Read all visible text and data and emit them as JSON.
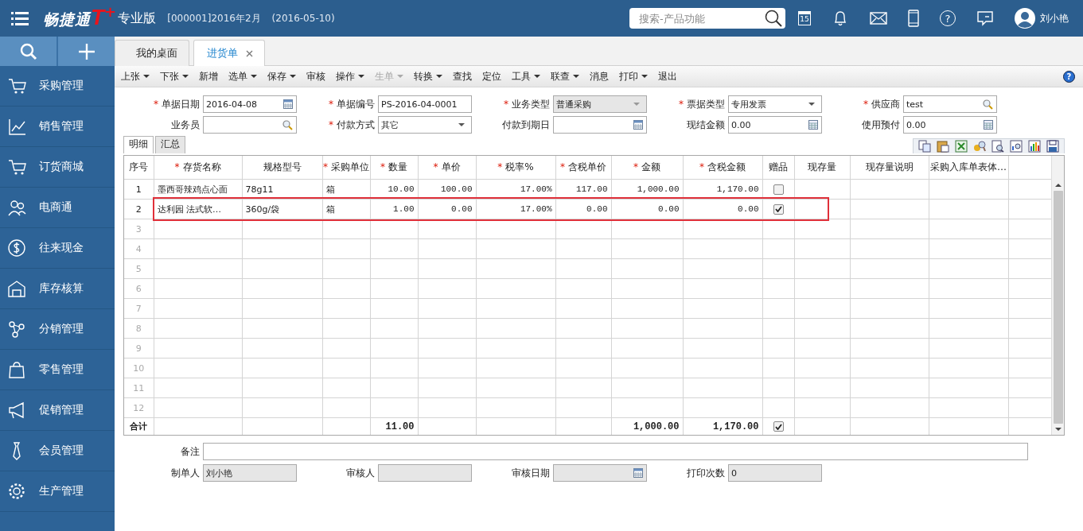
{
  "header": {
    "brand": "畅捷通",
    "brand_mark": "T",
    "brand_plus": "+",
    "edition": "专业版",
    "account": "[000001]2016年2月",
    "date": "(2016-05-10)",
    "search": {
      "placeholder": "搜索-产品功能"
    },
    "calendar_day": "15",
    "help": "?",
    "user": "刘小艳"
  },
  "sidebar": {
    "items": [
      {
        "label": "采购管理",
        "selected": false
      },
      {
        "label": "销售管理",
        "selected": false
      },
      {
        "label": "订货商城",
        "selected": false
      },
      {
        "label": "电商通",
        "selected": false
      },
      {
        "label": "往来现金",
        "selected": false
      },
      {
        "label": "库存核算",
        "selected": false
      },
      {
        "label": "分销管理",
        "selected": false
      },
      {
        "label": "零售管理",
        "selected": false
      },
      {
        "label": "促销管理",
        "selected": false
      },
      {
        "label": "会员管理",
        "selected": false
      },
      {
        "label": "生产管理",
        "selected": false
      }
    ]
  },
  "tabs": [
    {
      "label": "我的桌面",
      "selected": false,
      "closable": false
    },
    {
      "label": "进货单",
      "selected": true,
      "closable": true
    }
  ],
  "toolbar": {
    "items": [
      {
        "label": "上张",
        "dropdown": true,
        "disabled": false
      },
      {
        "label": "下张",
        "dropdown": true,
        "disabled": false
      },
      {
        "label": "新增",
        "dropdown": false,
        "disabled": false
      },
      {
        "label": "选单",
        "dropdown": true,
        "disabled": false
      },
      {
        "label": "保存",
        "dropdown": true,
        "disabled": false
      },
      {
        "label": "审核",
        "dropdown": false,
        "disabled": false
      },
      {
        "label": "操作",
        "dropdown": true,
        "disabled": false
      },
      {
        "label": "生单",
        "dropdown": true,
        "disabled": true
      },
      {
        "label": "转换",
        "dropdown": true,
        "disabled": false
      },
      {
        "label": "查找",
        "dropdown": false,
        "disabled": false
      },
      {
        "label": "定位",
        "dropdown": false,
        "disabled": false
      },
      {
        "label": "工具",
        "dropdown": true,
        "disabled": false
      },
      {
        "label": "联查",
        "dropdown": true,
        "disabled": false
      },
      {
        "label": "消息",
        "dropdown": false,
        "disabled": false
      },
      {
        "label": "打印",
        "dropdown": true,
        "disabled": false
      },
      {
        "label": "退出",
        "dropdown": false,
        "disabled": false
      }
    ],
    "help": "?"
  },
  "form": {
    "fields": [
      {
        "label": "单据日期",
        "mark": "*",
        "kind": "date",
        "value": "2016-04-08",
        "disabled": false
      },
      {
        "label": "单据编号",
        "mark": "*",
        "kind": "text",
        "value": "PS-2016-04-0001",
        "disabled": false
      },
      {
        "label": "业务类型",
        "mark": "*",
        "kind": "select",
        "value": "普通采购",
        "disabled": true
      },
      {
        "label": "票据类型",
        "mark": "*",
        "kind": "select",
        "value": "专用发票",
        "disabled": false
      },
      {
        "label": "供应商",
        "mark": "*",
        "kind": "search",
        "value": "test",
        "disabled": false
      },
      {
        "label": "业务员",
        "kind": "search",
        "disabled": false
      },
      {
        "label": "付款方式",
        "mark": "*",
        "kind": "select",
        "value": "其它",
        "disabled": false
      },
      {
        "label": "付款到期日",
        "kind": "date",
        "disabled": false
      },
      {
        "label": "现结金额",
        "kind": "calc",
        "value": "0.00",
        "disabled": false
      },
      {
        "label": "使用预付",
        "kind": "calc",
        "value": "0.00",
        "disabled": false
      }
    ]
  },
  "detail_tabs": [
    {
      "label": "明细",
      "selected": true
    },
    {
      "label": "汇总",
      "selected": false
    }
  ],
  "table": {
    "columns": [
      {
        "label": "序号",
        "kind": "index"
      },
      {
        "label": "存货名称",
        "mark": "*",
        "kind": "text"
      },
      {
        "label": "规格型号",
        "kind": "text"
      },
      {
        "label": "采购单位",
        "mark": "*",
        "kind": "text"
      },
      {
        "label": "数量",
        "mark": "*",
        "kind": "num"
      },
      {
        "label": "单价",
        "mark": "*",
        "kind": "num"
      },
      {
        "label": "税率%",
        "mark": "*",
        "kind": "num"
      },
      {
        "label": "含税单价",
        "mark": "*",
        "kind": "num"
      },
      {
        "label": "金额",
        "mark": "*",
        "kind": "num"
      },
      {
        "label": "含税金额",
        "mark": "*",
        "kind": "num"
      },
      {
        "label": "赠品",
        "kind": "check"
      },
      {
        "label": "现存量",
        "kind": "text"
      },
      {
        "label": "现存量说明",
        "kind": "text"
      },
      {
        "label": "采购入库单表体…",
        "kind": "text"
      }
    ],
    "rows": [
      {
        "index": "1",
        "cells": [
          "墨西哥辣鸡点心面",
          "78g11",
          "箱",
          "10.00",
          "100.00",
          "17.00%",
          "117.00",
          "1,000.00",
          "1,170.00"
        ],
        "gift": false,
        "highlighted": false
      },
      {
        "index": "2",
        "cells": [
          "达利园 法式软…",
          "360g/袋",
          "箱",
          "1.00",
          "0.00",
          "17.00%",
          "0.00",
          "0.00",
          "0.00"
        ],
        "gift": true,
        "highlighted": true
      },
      {
        "index": "3"
      },
      {
        "index": "4"
      },
      {
        "index": "5"
      },
      {
        "index": "6"
      },
      {
        "index": "7"
      },
      {
        "index": "8"
      },
      {
        "index": "9"
      },
      {
        "index": "10"
      },
      {
        "index": "11"
      },
      {
        "index": "12"
      }
    ],
    "total": {
      "index": "合计",
      "cells": [
        null,
        null,
        null,
        "11.00",
        null,
        null,
        null,
        "1,000.00",
        "1,170.00"
      ],
      "gift": true
    }
  },
  "footer": {
    "remark": {
      "label": "备注"
    },
    "fields": [
      {
        "label": "制单人",
        "kind": "text",
        "value": "刘小艳",
        "disabled": true
      },
      {
        "label": "审核人",
        "kind": "text",
        "disabled": true
      },
      {
        "label": "审核日期",
        "kind": "date",
        "disabled": true
      },
      {
        "label": "打印次数",
        "kind": "text",
        "value": "0",
        "disabled": true
      }
    ]
  }
}
